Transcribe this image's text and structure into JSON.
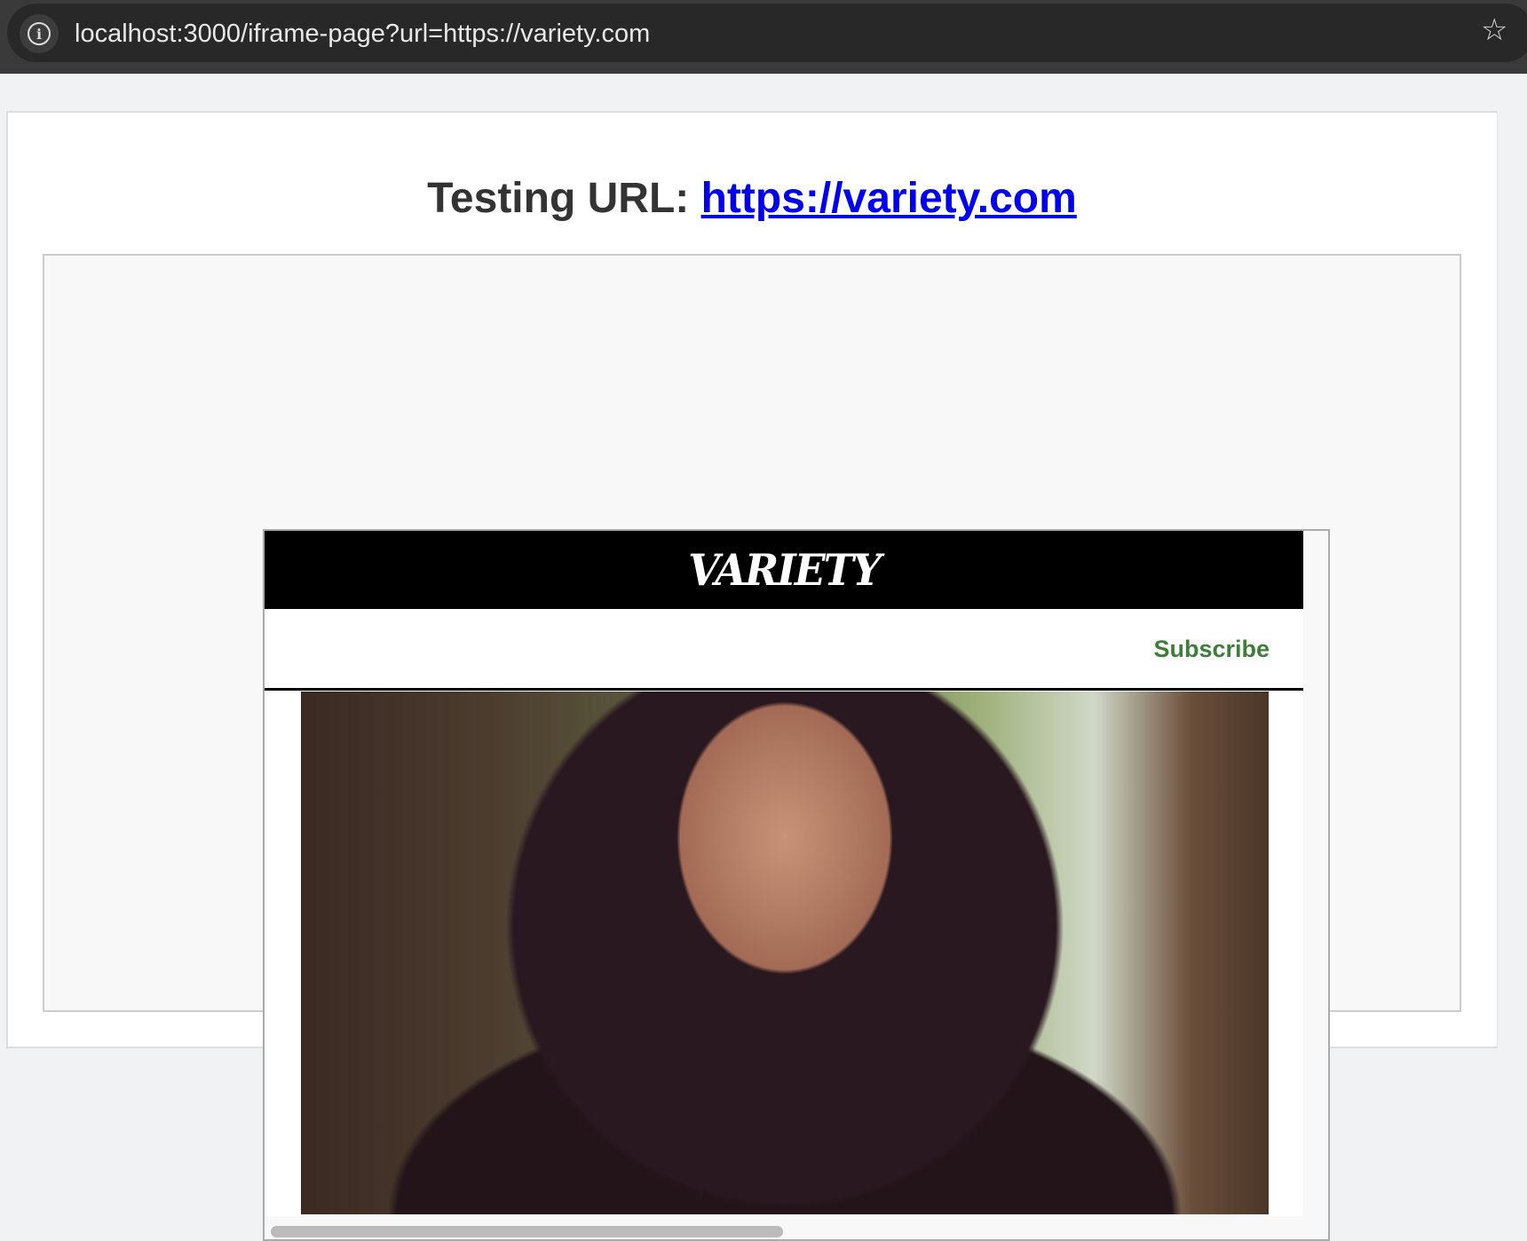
{
  "browser": {
    "url": "localhost:3000/iframe-page?url=https://variety.com",
    "info_icon": "info-icon",
    "star_icon": "star-icon"
  },
  "page": {
    "heading_prefix": "Testing URL:",
    "heading_link": "https://variety.com"
  },
  "iframe": {
    "logo": "VARIETY",
    "subscribe": "Subscribe",
    "hero_alt": "Hooded woman in forest"
  }
}
